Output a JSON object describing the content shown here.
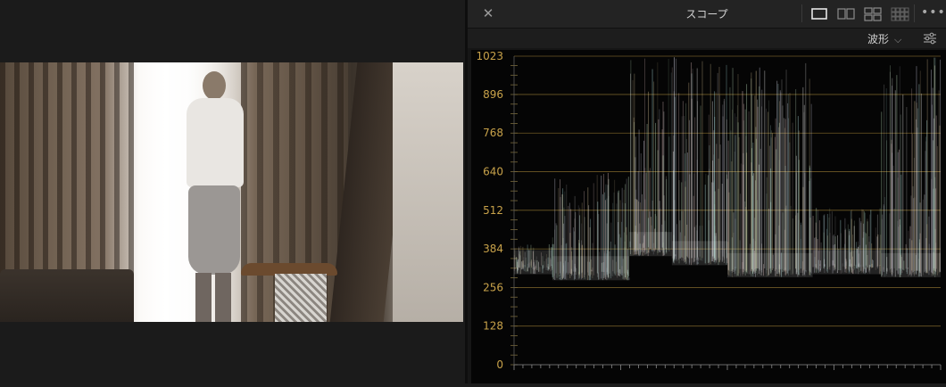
{
  "scope_panel": {
    "title": "スコープ",
    "close_icon": "close-icon",
    "layout_buttons": [
      "layout-single-icon",
      "layout-dual-icon",
      "layout-quad-icon",
      "layout-multi-icon"
    ],
    "more_icon": "more-horizontal-icon",
    "mode": {
      "selected": "波形",
      "icon": "chevron-down-icon"
    },
    "settings_icon": "sliders-icon",
    "accent_color": "#c8a24a"
  },
  "viewer": {
    "frame_description": "video-frame"
  },
  "chart_data": {
    "type": "heatmap",
    "title": "",
    "xlabel": "",
    "ylabel": "",
    "ylim": [
      0,
      1023
    ],
    "y_ticks": [
      0,
      128,
      256,
      384,
      512,
      640,
      768,
      896,
      1023
    ],
    "y_tick_labels": [
      "0",
      "128",
      "256",
      "384",
      "512",
      "640",
      "768",
      "896",
      "1023"
    ],
    "grid": true,
    "waveform_regions": [
      {
        "x_start": 0.0,
        "x_end": 0.09,
        "low": 300,
        "high": 400
      },
      {
        "x_start": 0.09,
        "x_end": 0.27,
        "low": 280,
        "high": 640
      },
      {
        "x_start": 0.27,
        "x_end": 0.37,
        "low": 360,
        "high": 1023
      },
      {
        "x_start": 0.37,
        "x_end": 0.5,
        "low": 330,
        "high": 1023
      },
      {
        "x_start": 0.5,
        "x_end": 0.7,
        "low": 290,
        "high": 1000
      },
      {
        "x_start": 0.7,
        "x_end": 0.86,
        "low": 300,
        "high": 520
      },
      {
        "x_start": 0.86,
        "x_end": 1.0,
        "low": 290,
        "high": 1023
      }
    ]
  }
}
